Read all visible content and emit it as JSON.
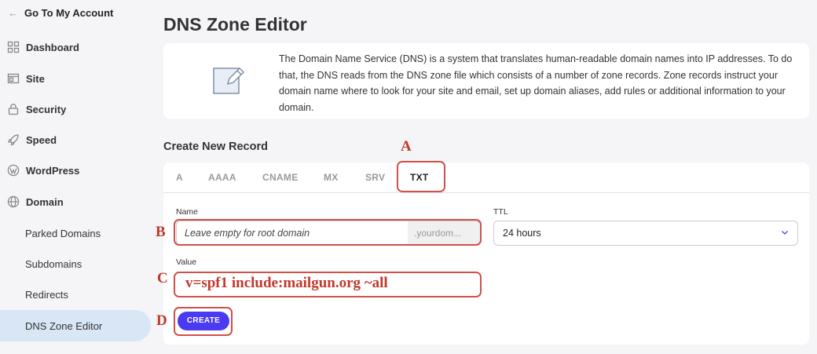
{
  "sidebar": {
    "back_label": "Go To My Account",
    "items": [
      {
        "label": "Dashboard",
        "icon": "grid-icon"
      },
      {
        "label": "Site",
        "icon": "site-icon"
      },
      {
        "label": "Security",
        "icon": "lock-icon"
      },
      {
        "label": "Speed",
        "icon": "rocket-icon"
      },
      {
        "label": "WordPress",
        "icon": "wordpress-icon"
      },
      {
        "label": "Domain",
        "icon": "globe-icon"
      }
    ],
    "sub_items": [
      {
        "label": "Parked Domains"
      },
      {
        "label": "Subdomains"
      },
      {
        "label": "Redirects"
      },
      {
        "label": "DNS Zone Editor",
        "active": true
      }
    ]
  },
  "main": {
    "title": "DNS Zone Editor",
    "description": "The Domain Name Service (DNS) is a system that translates human-readable domain names into IP addresses. To do that, the DNS reads from the DNS zone file which consists of a number of zone records. Zone records instruct your domain name where to look for your site and email, set up domain aliases, add rules or additional information to your domain.",
    "section_title": "Create New Record",
    "tabs": [
      "A",
      "AAAA",
      "CNAME",
      "MX",
      "SRV",
      "TXT"
    ],
    "active_tab": "TXT",
    "name_label": "Name",
    "name_placeholder": "Leave empty for root domain",
    "name_suffix": ".yourdom...",
    "ttl_label": "TTL",
    "ttl_value": "24 hours",
    "value_label": "Value",
    "value_text": "v=spf1 include:mailgun.org ~all",
    "create_label": "CREATE"
  },
  "annotations": [
    "A",
    "B",
    "C",
    "D"
  ],
  "colors": {
    "accent": "#4a3af2",
    "annotation": "#c0392b",
    "active_nav": "#d8e6f6"
  }
}
